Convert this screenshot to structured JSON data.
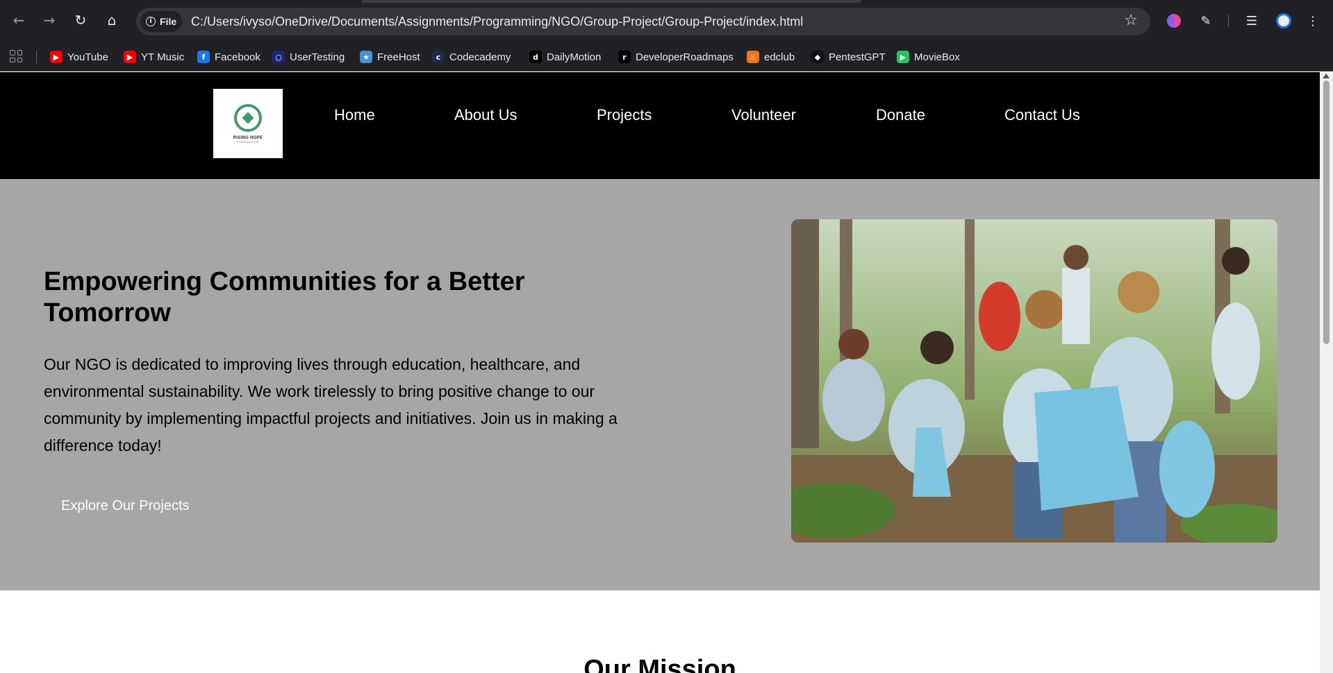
{
  "browser": {
    "site_chip": "File",
    "url": "C:/Users/ivyso/OneDrive/Documents/Assignments/Programming/NGO/Group-Project/Group-Project/index.html",
    "bookmarks": [
      {
        "label": "YouTube",
        "icon": "youtube-icon",
        "color": "#ff0000"
      },
      {
        "label": "YT Music",
        "icon": "yt-music-icon",
        "color": "#ff0000"
      },
      {
        "label": "Facebook",
        "icon": "facebook-icon",
        "color": "#1877f2"
      },
      {
        "label": "UserTesting",
        "icon": "usertesting-icon",
        "color": "#1a237e"
      },
      {
        "label": "FreeHost",
        "icon": "freehost-icon",
        "color": "#4a90d9"
      },
      {
        "label": "Codecademy",
        "icon": "codecademy-icon",
        "color": "#1f2a44"
      },
      {
        "label": "DailyMotion",
        "icon": "dailymotion-icon",
        "color": "#000000"
      },
      {
        "label": "DeveloperRoadmaps",
        "icon": "roadmap-icon",
        "color": "#000000"
      },
      {
        "label": "edclub",
        "icon": "edclub-icon",
        "color": "#f97316"
      },
      {
        "label": "PentestGPT",
        "icon": "pentestgpt-icon",
        "color": "#111111"
      },
      {
        "label": "MovieBox",
        "icon": "moviebox-icon",
        "color": "#22c55e"
      }
    ]
  },
  "site": {
    "logo_text": "RISING HOPE",
    "logo_sub": "FOUNDATION",
    "nav": [
      "Home",
      "About Us",
      "Projects",
      "Volunteer",
      "Donate",
      "Contact Us"
    ],
    "hero": {
      "title": "Empowering Communities for a Better Tomorrow",
      "text": "Our NGO is dedicated to improving lives through education, healthcare, and environmental sustainability. We work tirelessly to bring positive change to our community by implementing impactful projects and initiatives. Join us in making a difference today!",
      "button": "Explore Our Projects",
      "image_alt": "volunteers-cleaning-park-photo"
    },
    "mission_title": "Our Mission"
  },
  "colors": {
    "header_bg": "#000000",
    "hero_bg": "#a6a6a6",
    "logo_green": "#3f9a6a"
  }
}
